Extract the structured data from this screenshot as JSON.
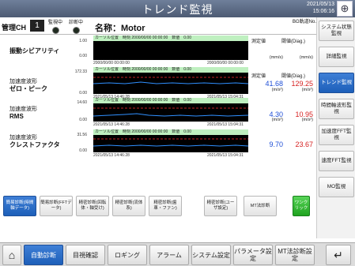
{
  "header": {
    "title": "トレンド監視",
    "date": "2021/05/13",
    "time": "15:06:16"
  },
  "info": {
    "ch_label": "管理CH",
    "ch_value": "1",
    "led1": "監視中",
    "led2": "診断中",
    "name": "名称：Motor",
    "bg_label": "BG軌道No.",
    "bg_no": "No."
  },
  "side_menu": [
    {
      "label": "システム状態監視"
    },
    {
      "label": "詳細監視"
    },
    {
      "label": "トレンド監視"
    },
    {
      "label": "時間軸波形監視"
    },
    {
      "label": "加速度FFT監視"
    },
    {
      "label": "速度FFT監視"
    },
    {
      "label": "MO監視"
    }
  ],
  "columns": {
    "measured": "測定値",
    "threshold": "閾値(Diag.)"
  },
  "rows": [
    {
      "title": "振動シビアリティ",
      "subtitle": "",
      "measured": "",
      "threshold": "",
      "unit_measured": "(mm/s)",
      "unit_threshold": "(mm/s)",
      "bar": "カーソル位置　時刻 2000/00/00 00:00:00　数値　0.00",
      "ymax": "1.00",
      "ymin": "0.00",
      "ts_left": "2000/00/00 00:00:00",
      "ts_right": "2000/00/00 00:00:00"
    },
    {
      "title": "加速度波形",
      "subtitle": "ゼロ・ピーク",
      "measured": "41.68",
      "threshold": "129.25",
      "unit_measured": "(m/s²)",
      "unit_threshold": "(m/s²)",
      "bar": "カーソル位置　時刻 2000/00/00 00:00:00　数値　0.00",
      "ymax": "172.33",
      "ymin": "0.00",
      "ts_left": "2021/05/13 14:46:28",
      "ts_right": "2021/05/13 15:04:31"
    },
    {
      "title": "加速度波形",
      "subtitle": "RMS",
      "measured": "4.30",
      "threshold": "10.95",
      "unit_measured": "(m/s²)",
      "unit_threshold": "(m/s²)",
      "bar": "カーソル位置　時刻 2000/00/00 00:00:00　数値　0.00",
      "ymax": "14.60",
      "ymin": "0.00",
      "ts_left": "2021/05/13 14:46:28",
      "ts_right": "2021/05/13 15:04:31"
    },
    {
      "title": "加速度波形",
      "subtitle": "クレストファクタ",
      "measured": "9.70",
      "threshold": "23.67",
      "unit_measured": "",
      "unit_threshold": "",
      "bar": "カーソル位置　時刻 2000/00/00 00:00:00　数値　0.00",
      "ymax": "31.56",
      "ymin": "0.00",
      "ts_left": "2021/05/13 14:46:28",
      "ts_right": "2021/05/13 15:04:31"
    }
  ],
  "subtabs": [
    {
      "label": "簡易診断(時間軸データ)"
    },
    {
      "label": "簡易診断(FFTデータ)"
    },
    {
      "label": "精密診断(回転体・軸受け)"
    },
    {
      "label": "精密診断(流体系)"
    },
    {
      "label": "精密診断(歯車・ファン)"
    },
    {
      "label": "精密診断(ユーザ設定)"
    },
    {
      "label": "MT法診断"
    },
    {
      "label": "ワンクリック"
    }
  ],
  "footer": {
    "home": "⌂",
    "items": [
      {
        "label": "自動診断"
      },
      {
        "label": "目視確認"
      },
      {
        "label": "ロギング"
      },
      {
        "label": "アラーム"
      },
      {
        "label": "システム設定"
      },
      {
        "label": "パラメータ設定"
      },
      {
        "label": "MT法診断設定"
      }
    ],
    "back": "↵"
  },
  "colors": {
    "accent": "#1d5fb9",
    "measured": "#1f4fd6",
    "threshold": "#d62020",
    "plot_bg": "#000000",
    "cursor_bar": "#bff0c0"
  }
}
